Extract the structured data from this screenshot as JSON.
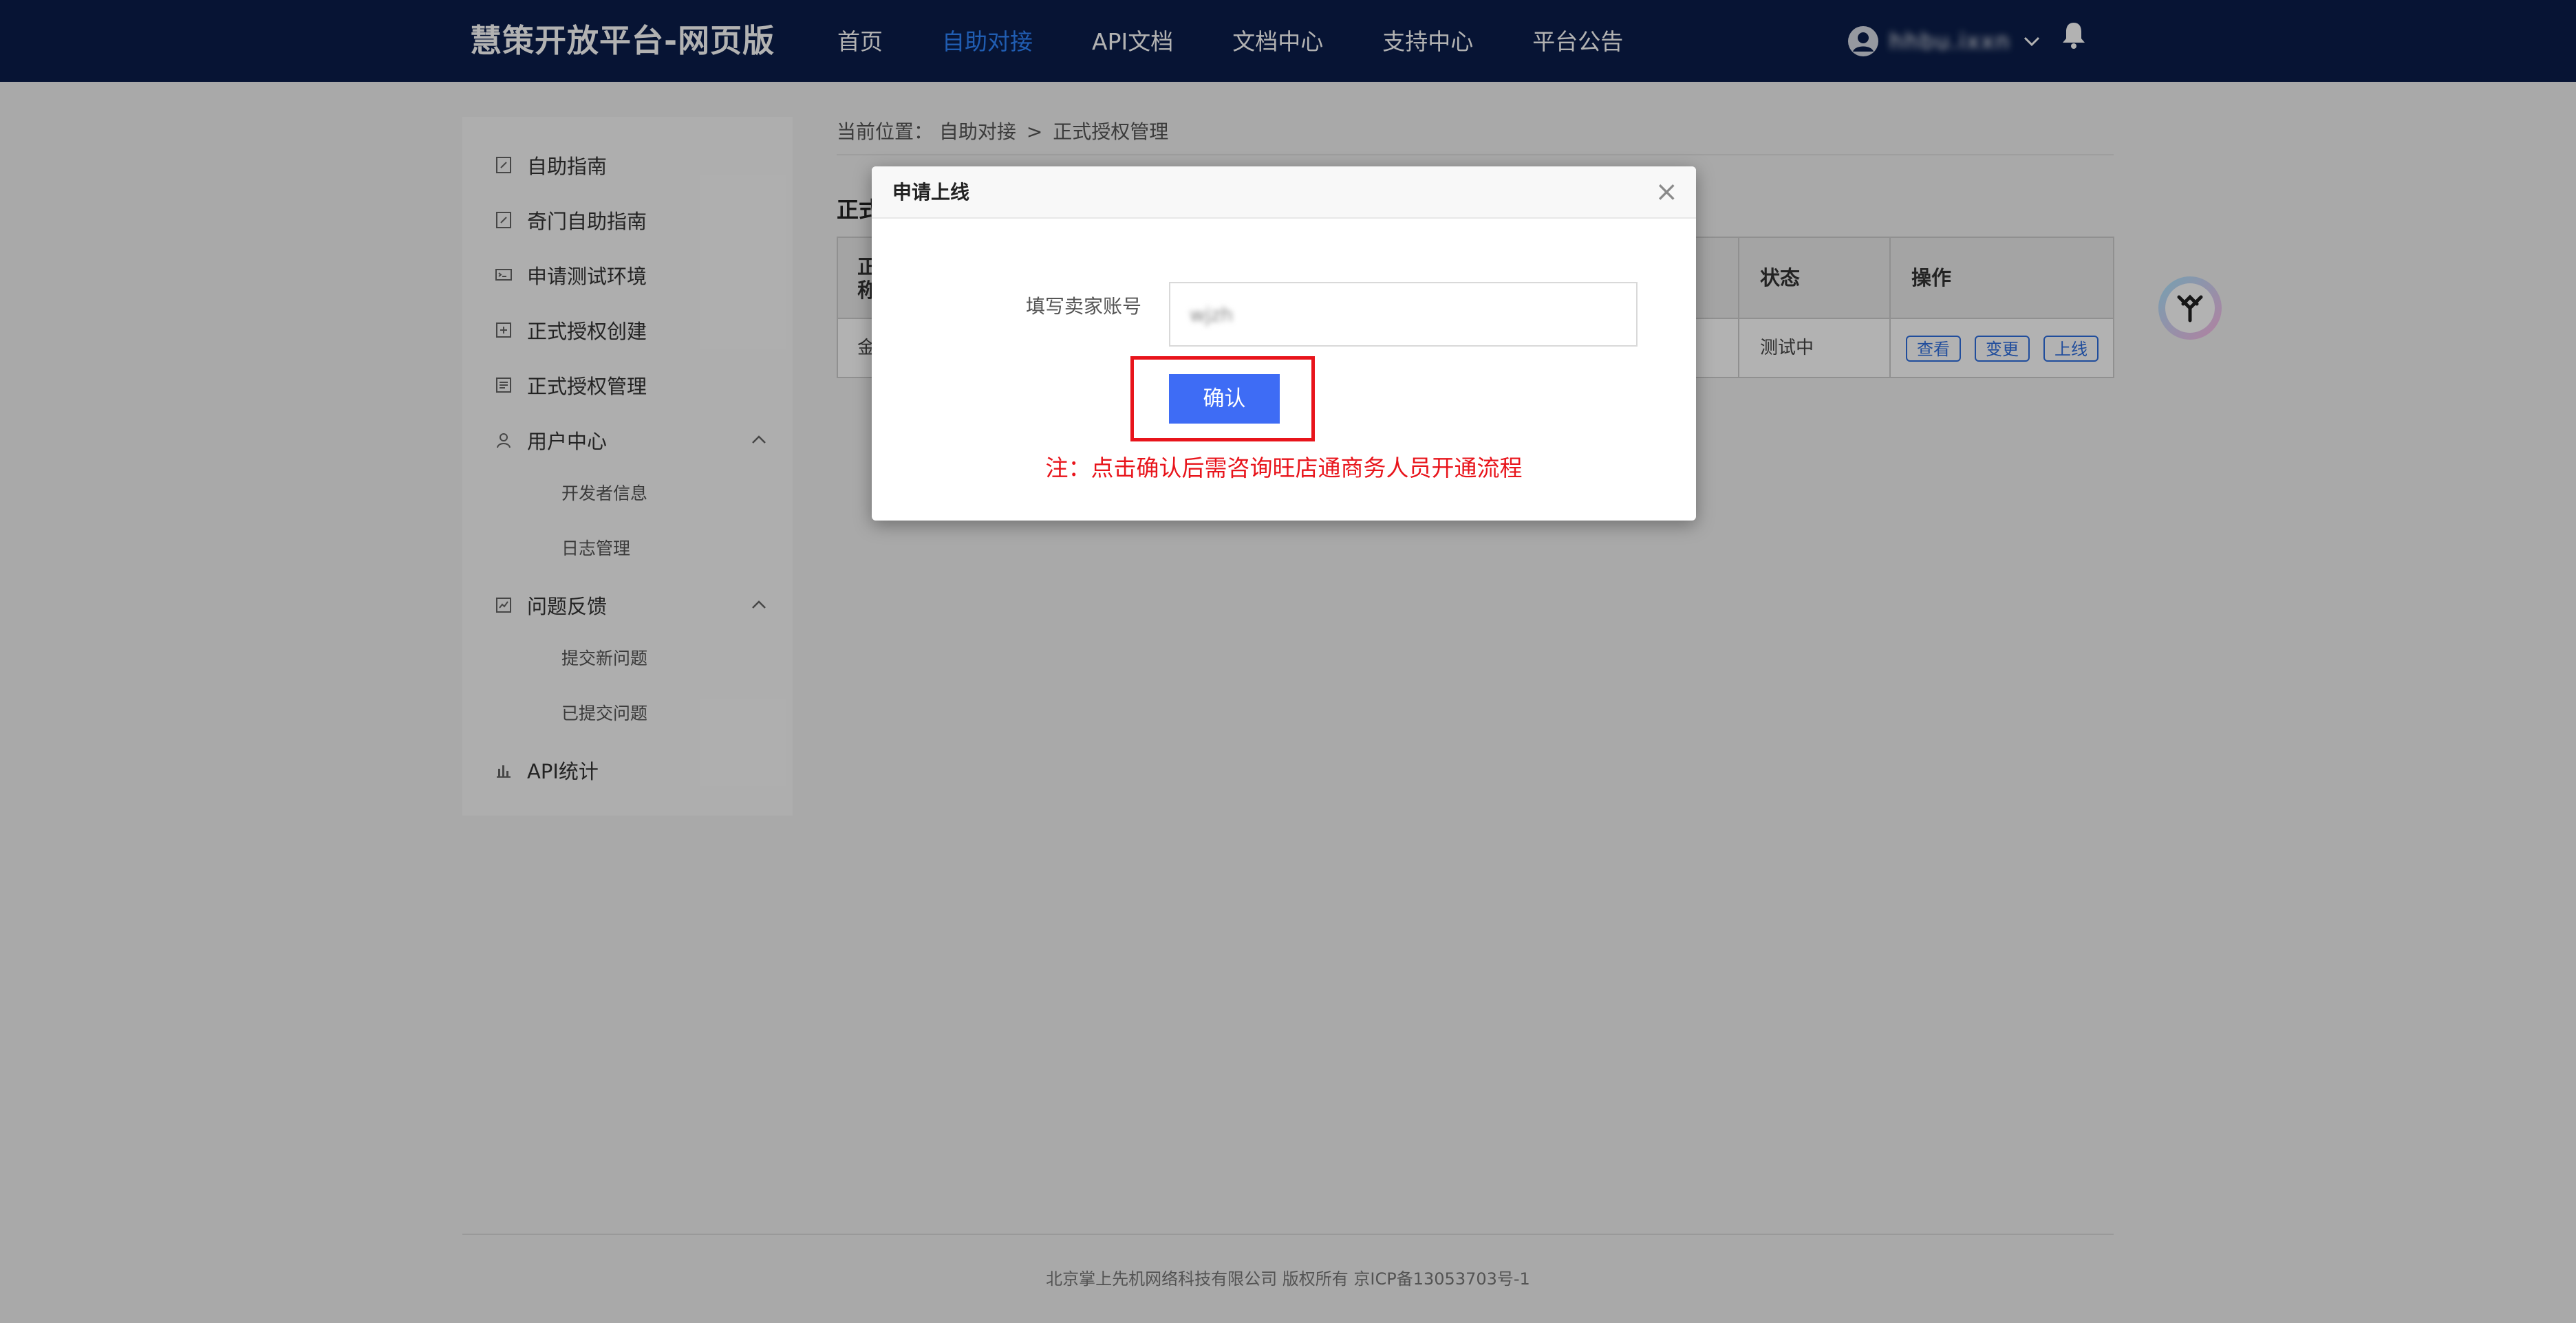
{
  "header": {
    "brand": "慧策开放平台-网页版",
    "nav": [
      {
        "label": "首页",
        "active": false
      },
      {
        "label": "自助对接",
        "active": true
      },
      {
        "label": "API文档",
        "active": false
      },
      {
        "label": "文档中心",
        "active": false
      },
      {
        "label": "支持中心",
        "active": false
      },
      {
        "label": "平台公告",
        "active": false
      }
    ],
    "username": "hhbu.ixxn",
    "icons": [
      "user-avatar-icon",
      "chevron-down-icon",
      "bell-icon"
    ]
  },
  "sidebar": {
    "items": [
      {
        "label": "自助指南",
        "icon": "document-edit-icon"
      },
      {
        "label": "奇门自助指南",
        "icon": "document-edit-icon"
      },
      {
        "label": "申请测试环境",
        "icon": "terminal-icon"
      },
      {
        "label": "正式授权创建",
        "icon": "add-document-icon"
      },
      {
        "label": "正式授权管理",
        "icon": "list-document-icon"
      },
      {
        "label": "用户中心",
        "icon": "user-icon",
        "expanded": true
      },
      {
        "label": "问题反馈",
        "icon": "chart-check-icon",
        "expanded": true
      },
      {
        "label": "API统计",
        "icon": "bar-chart-icon"
      }
    ],
    "user_center_sub": [
      "开发者信息",
      "日志管理"
    ],
    "feedback_sub": [
      "提交新问题",
      "已提交问题"
    ]
  },
  "breadcrumb": {
    "prefix": "当前位置：",
    "path": [
      "自助对接",
      "正式授权管理"
    ],
    "separator": ">"
  },
  "section_title": "正式",
  "table": {
    "first_header_fragment_line1": "正",
    "first_header_fragment_line2": "称",
    "status_header": "状态",
    "ops_header": "操作",
    "row_first_fragment": "金",
    "row_status": "测试中",
    "ops": [
      "查看",
      "变更",
      "上线"
    ]
  },
  "modal": {
    "title": "申请上线",
    "close": "×",
    "field_label": "填写卖家账号",
    "field_value": "wjzh",
    "confirm_label": "确认",
    "note": "注：点击确认后需咨询旺店通商务人员开通流程"
  },
  "footer": "北京掌上先机网络科技有限公司 版权所有 京ICP备13053703号-1",
  "colors": {
    "header_bg": "#0b1e4b",
    "nav_active": "#2f86ff",
    "primary_button": "#3e6cf5",
    "highlight": "#e8141b"
  }
}
